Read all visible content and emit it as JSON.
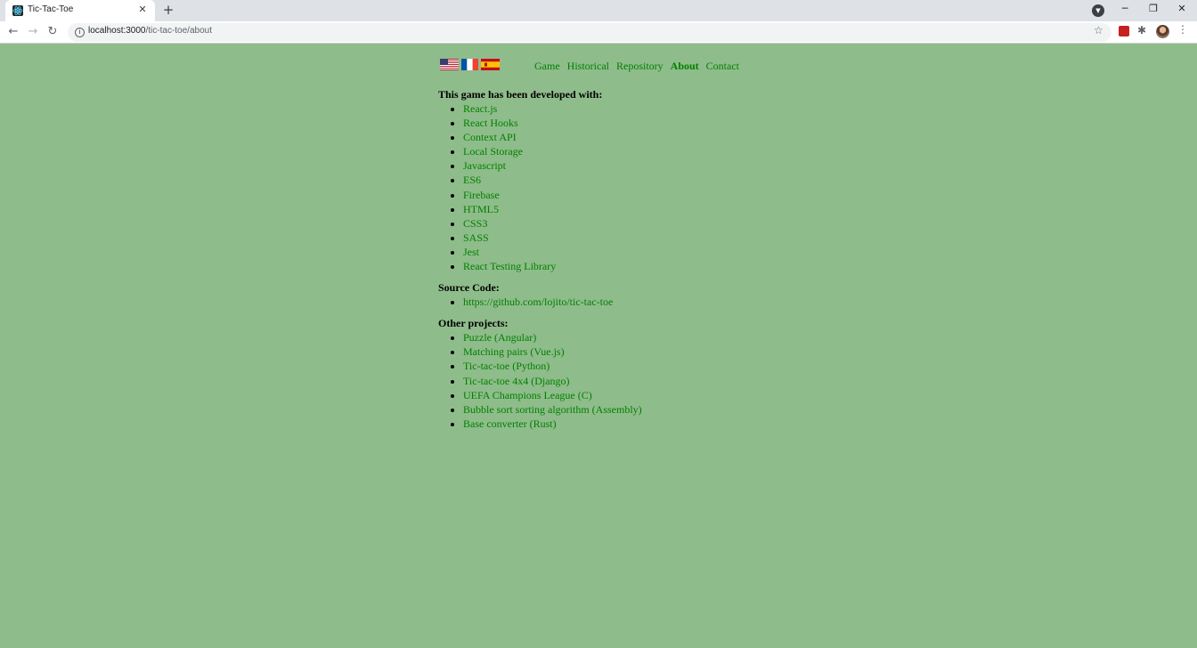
{
  "browser": {
    "tab_title": "Tic-Tac-Toe",
    "tab_close": "✕",
    "new_tab": "+",
    "url_host": "localhost:3000",
    "url_path": "/tic-tac-toe/about",
    "controls": {
      "minimize": "─",
      "restore": "❐",
      "close": "✕"
    },
    "nav": {
      "back": "←",
      "forward": "→",
      "reload": "↻"
    },
    "info": "i",
    "star": "☆",
    "puzzle": "✱",
    "menu": "⋮",
    "tabsearch": "▼"
  },
  "header": {
    "flags": [
      "flag-us",
      "flag-fr",
      "flag-es"
    ],
    "nav": [
      "Game",
      "Historical",
      "Repository",
      "About",
      "Contact"
    ],
    "active": "About"
  },
  "sections": {
    "developed": {
      "title": "This game has been developed with:",
      "items": [
        "React.js",
        "React Hooks",
        "Context API",
        "Local Storage",
        "Javascript",
        "ES6",
        "Firebase",
        "HTML5",
        "CSS3",
        "SASS",
        "Jest",
        "React Testing Library"
      ]
    },
    "source": {
      "title": "Source Code:",
      "items": [
        "https://github.com/lojito/tic-tac-toe"
      ]
    },
    "other": {
      "title": "Other projects:",
      "items": [
        "Puzzle (Angular)",
        "Matching pairs (Vue.js)",
        "Tic-tac-toe (Python)",
        "Tic-tac-toe 4x4 (Django)",
        "UEFA Champions League (C)",
        "Bubble sort sorting algorithm (Assembly)",
        "Base converter (Rust)"
      ]
    }
  },
  "colors": {
    "page_bg": "#8fbc8b",
    "link": "#008000"
  }
}
